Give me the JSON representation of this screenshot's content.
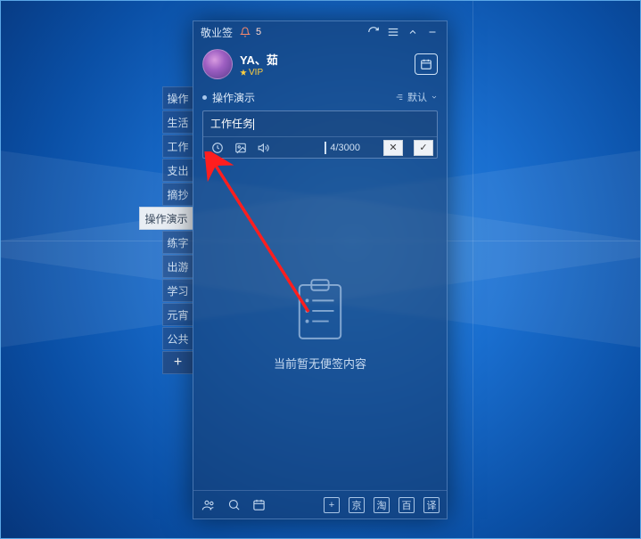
{
  "app": {
    "title": "敬业签",
    "notif_count": "5"
  },
  "user": {
    "name": "YA、茹",
    "vip": "VIP"
  },
  "section": {
    "title": "操作演示",
    "sort_label": "默认"
  },
  "editor": {
    "value": "工作任务",
    "count": "4",
    "max": "/3000"
  },
  "empty": {
    "message": "当前暂无便签内容"
  },
  "footer": {
    "add": "+",
    "jing": "京",
    "tao": "淘",
    "bai": "百",
    "yi": "译"
  },
  "side_tabs": [
    {
      "label": "操作"
    },
    {
      "label": "生活"
    },
    {
      "label": "工作"
    },
    {
      "label": "支出"
    },
    {
      "label": "摘抄"
    },
    {
      "label": "操作演示",
      "active": true
    },
    {
      "label": "练字"
    },
    {
      "label": "出游"
    },
    {
      "label": "学习"
    },
    {
      "label": "元宵"
    },
    {
      "label": "公共"
    }
  ],
  "side_add": "+"
}
